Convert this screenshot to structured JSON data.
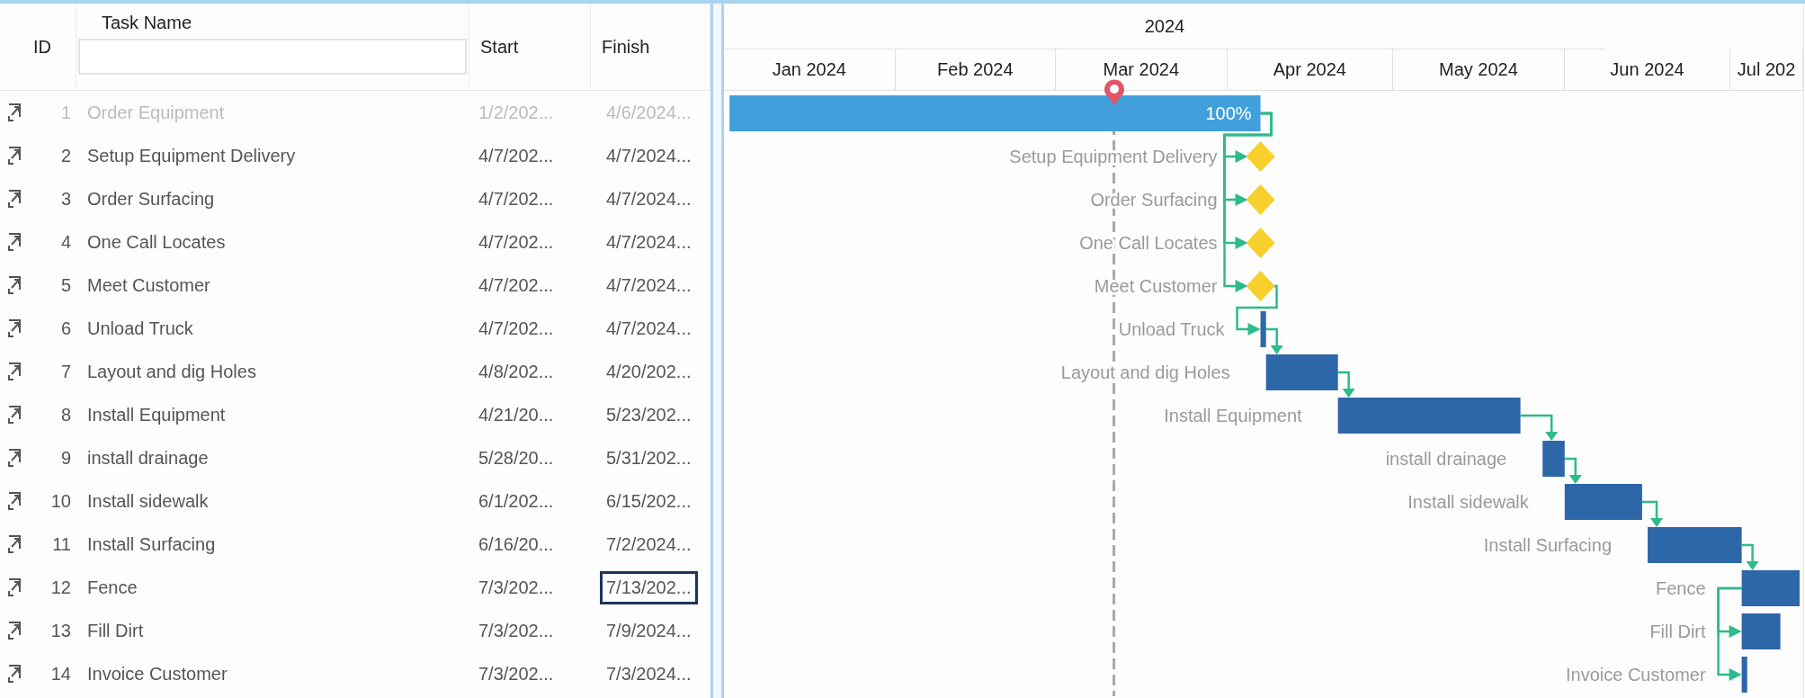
{
  "columns": {
    "id": "ID",
    "name": "Task Name",
    "start": "Start",
    "finish": "Finish"
  },
  "timescale": {
    "year": "2024",
    "months": [
      "Jan 2024",
      "Feb 2024",
      "Mar 2024",
      "Apr 2024",
      "May 2024",
      "Jun 2024",
      "Jul 202"
    ]
  },
  "tasks": [
    {
      "id": "1",
      "name": "Order Equipment",
      "start": "1/2/202...",
      "finish": "4/6/2024...",
      "kind": "bar",
      "completed": true,
      "selected": false,
      "progress": "100%"
    },
    {
      "id": "2",
      "name": "Setup Equipment Delivery",
      "start": "4/7/202...",
      "finish": "4/7/2024...",
      "kind": "milestone",
      "completed": false,
      "selected": false,
      "bar_label": "Setup Equipment Delivery"
    },
    {
      "id": "3",
      "name": "Order Surfacing",
      "start": "4/7/202...",
      "finish": "4/7/2024...",
      "kind": "milestone",
      "completed": false,
      "selected": false,
      "bar_label": "Order Surfacing"
    },
    {
      "id": "4",
      "name": "One Call Locates",
      "start": "4/7/202...",
      "finish": "4/7/2024...",
      "kind": "milestone",
      "completed": false,
      "selected": false,
      "bar_label": "One Call Locates"
    },
    {
      "id": "5",
      "name": "Meet Customer",
      "start": "4/7/202...",
      "finish": "4/7/2024...",
      "kind": "milestone",
      "completed": false,
      "selected": false,
      "bar_label": "Meet Customer"
    },
    {
      "id": "6",
      "name": "Unload Truck",
      "start": "4/7/202...",
      "finish": "4/7/2024...",
      "kind": "bar",
      "completed": false,
      "selected": false,
      "bar_label": "Unload Truck"
    },
    {
      "id": "7",
      "name": "Layout and dig Holes",
      "start": "4/8/202...",
      "finish": "4/20/202...",
      "kind": "bar",
      "completed": false,
      "selected": false,
      "bar_label": "Layout and dig Holes"
    },
    {
      "id": "8",
      "name": "Install Equipment",
      "start": "4/21/20...",
      "finish": "5/23/202...",
      "kind": "bar",
      "completed": false,
      "selected": false,
      "bar_label": "Install Equipment"
    },
    {
      "id": "9",
      "name": "install drainage",
      "start": "5/28/20...",
      "finish": "5/31/202...",
      "kind": "bar",
      "completed": false,
      "selected": false,
      "bar_label": "install drainage"
    },
    {
      "id": "10",
      "name": "Install sidewalk",
      "start": "6/1/202...",
      "finish": "6/15/202...",
      "kind": "bar",
      "completed": false,
      "selected": false,
      "bar_label": "Install sidewalk"
    },
    {
      "id": "11",
      "name": "Install Surfacing",
      "start": "6/16/20...",
      "finish": "7/2/2024...",
      "kind": "bar",
      "completed": false,
      "selected": false,
      "bar_label": "Install Surfacing"
    },
    {
      "id": "12",
      "name": "Fence",
      "start": "7/3/202...",
      "finish": "7/13/202...",
      "kind": "bar",
      "completed": false,
      "selected": true,
      "bar_label": "Fence"
    },
    {
      "id": "13",
      "name": "Fill Dirt",
      "start": "7/3/202...",
      "finish": "7/9/2024...",
      "kind": "bar",
      "completed": false,
      "selected": false,
      "bar_label": "Fill Dirt"
    },
    {
      "id": "14",
      "name": "Invoice Customer",
      "start": "7/3/202...",
      "finish": "7/3/2024...",
      "kind": "bar",
      "completed": false,
      "selected": false,
      "bar_label": "Invoice Customer"
    }
  ]
}
